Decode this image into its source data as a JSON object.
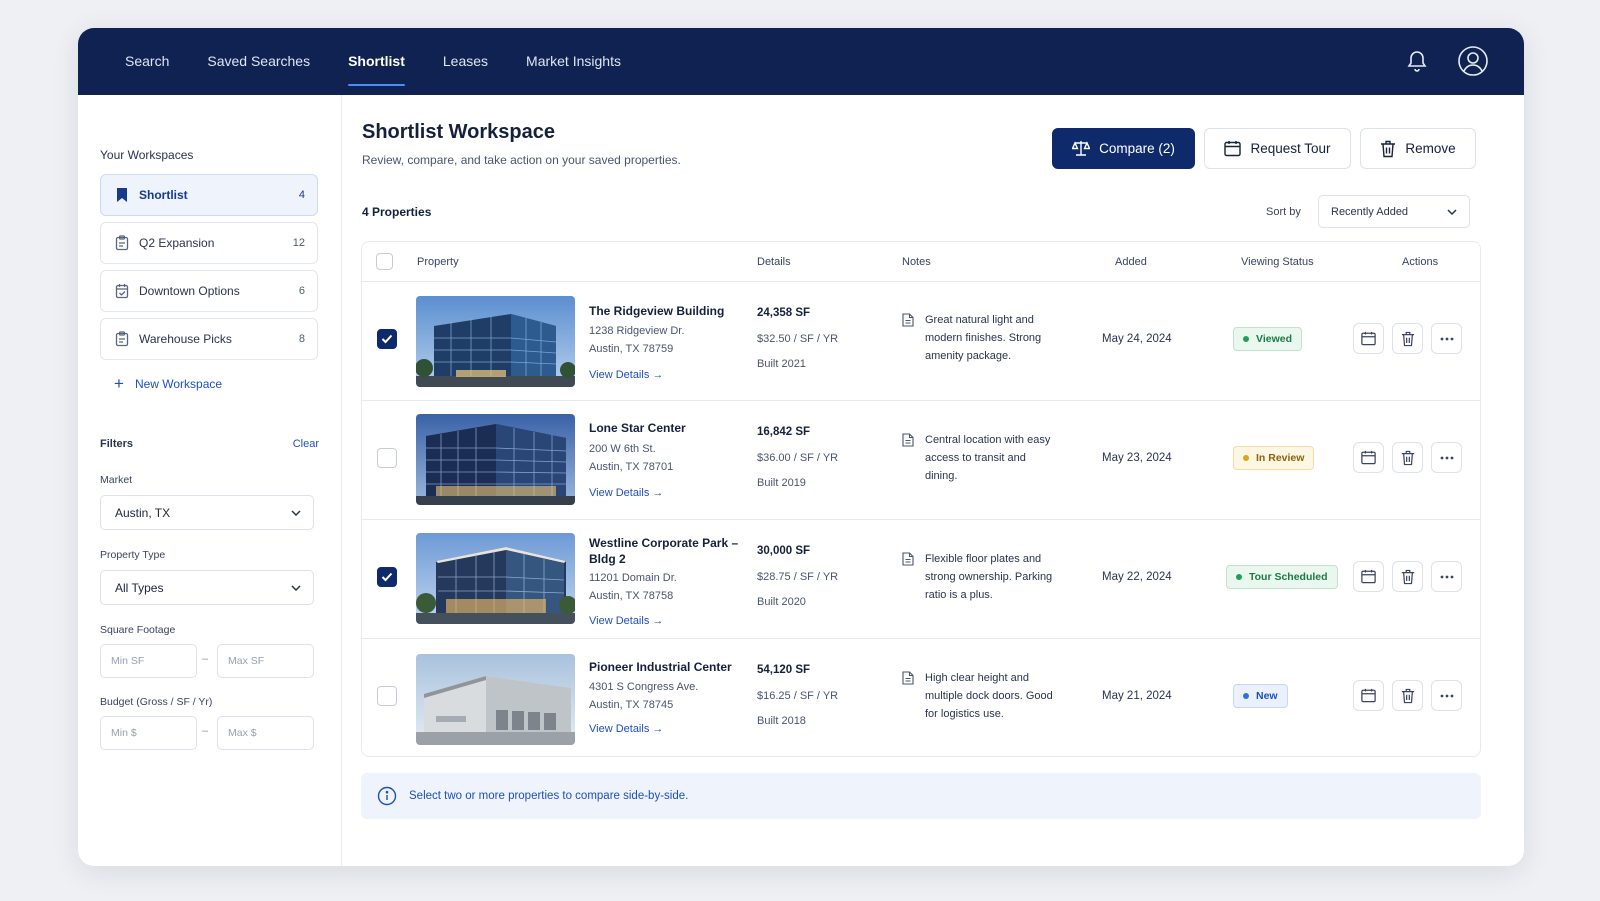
{
  "nav": {
    "items": [
      "Search",
      "Saved Searches",
      "Shortlist",
      "Leases",
      "Market Insights"
    ],
    "active": "Shortlist"
  },
  "sidebar": {
    "title": "Your Workspaces",
    "workspaces": [
      {
        "label": "Shortlist",
        "count": "4",
        "icon": "bookmark-icon"
      },
      {
        "label": "Q2 Expansion",
        "count": "12",
        "icon": "clipboard-icon"
      },
      {
        "label": "Downtown Options",
        "count": "6",
        "icon": "calendar-check-icon"
      },
      {
        "label": "Warehouse Picks",
        "count": "8",
        "icon": "clipboard-icon"
      }
    ],
    "new_workspace": "New Workspace",
    "filters": {
      "title": "Filters",
      "clear": "Clear",
      "market_label": "Market",
      "market_value": "Austin, TX",
      "type_label": "Property Type",
      "type_value": "All Types",
      "sf_label": "Square Footage",
      "sf_min_placeholder": "Min SF",
      "sf_max_placeholder": "Max SF",
      "budget_label": "Budget (Gross / SF / Yr)",
      "budget_min_placeholder": "Min $",
      "budget_max_placeholder": "Max $",
      "range_sep": "–"
    }
  },
  "main": {
    "title": "Shortlist Workspace",
    "subtitle": "Review, compare, and take action on your saved properties.",
    "compare_label": "Compare (2)",
    "tour_label": "Request Tour",
    "remove_label": "Remove",
    "count_label": "4 Properties",
    "sort_label": "Sort by",
    "sort_value": "Recently Added",
    "columns": [
      "Property",
      "Details",
      "Notes",
      "Added",
      "Viewing Status",
      "Actions"
    ],
    "info": "Select two or more properties to compare side-by-side."
  },
  "rows": [
    {
      "checked": true,
      "name": "The Ridgeview Building",
      "address1": "1238 Ridgeview Dr.",
      "address2": "Austin, TX 78759",
      "link": "View Details →",
      "sf": "24,358 SF",
      "rate": "$32.50 / SF / YR",
      "built": "Built 2021",
      "notes": "Great natural light and modern finishes. Strong amenity package.",
      "added": "May 24, 2024",
      "status": "Viewed"
    },
    {
      "checked": false,
      "name": "Lone Star Center",
      "address1": "200 W 6th St.",
      "address2": "Austin, TX 78701",
      "link": "View Details →",
      "sf": "16,842 SF",
      "rate": "$36.00 / SF / YR",
      "built": "Built 2019",
      "notes": "Central location with easy access to transit and dining.",
      "added": "May 23, 2024",
      "status": "In Review"
    },
    {
      "checked": true,
      "name": "Westline Corporate Park – Bldg 2",
      "address1": "11201 Domain Dr.",
      "address2": "Austin, TX 78758",
      "link": "View Details →",
      "sf": "30,000 SF",
      "rate": "$28.75 / SF / YR",
      "built": "Built 2020",
      "notes": "Flexible floor plates and strong ownership. Parking ratio is a plus.",
      "added": "May 22, 2024",
      "status": "Tour Scheduled"
    },
    {
      "checked": false,
      "name": "Pioneer Industrial Center",
      "address1": "4301 S Congress Ave.",
      "address2": "Austin, TX 78745",
      "link": "View Details →",
      "sf": "54,120 SF",
      "rate": "$16.25 / SF / YR",
      "built": "Built 2018",
      "notes": "High clear height and multiple dock doors. Good for logistics use.",
      "added": "May 21, 2024",
      "status": "New"
    }
  ],
  "colors": {
    "nav_bg": "#0f2252",
    "primary": "#0f2a6b",
    "link": "#1f4fbf",
    "viewed": "#1e9e57",
    "in_review": "#e0a21b",
    "tour_scheduled": "#1e9e57",
    "new": "#2f6fe0"
  },
  "icons": [
    "bell-icon",
    "user-icon",
    "scale-icon",
    "calendar-icon",
    "trash-icon",
    "more-icon",
    "note-icon",
    "info-icon",
    "chevron-down-icon"
  ]
}
